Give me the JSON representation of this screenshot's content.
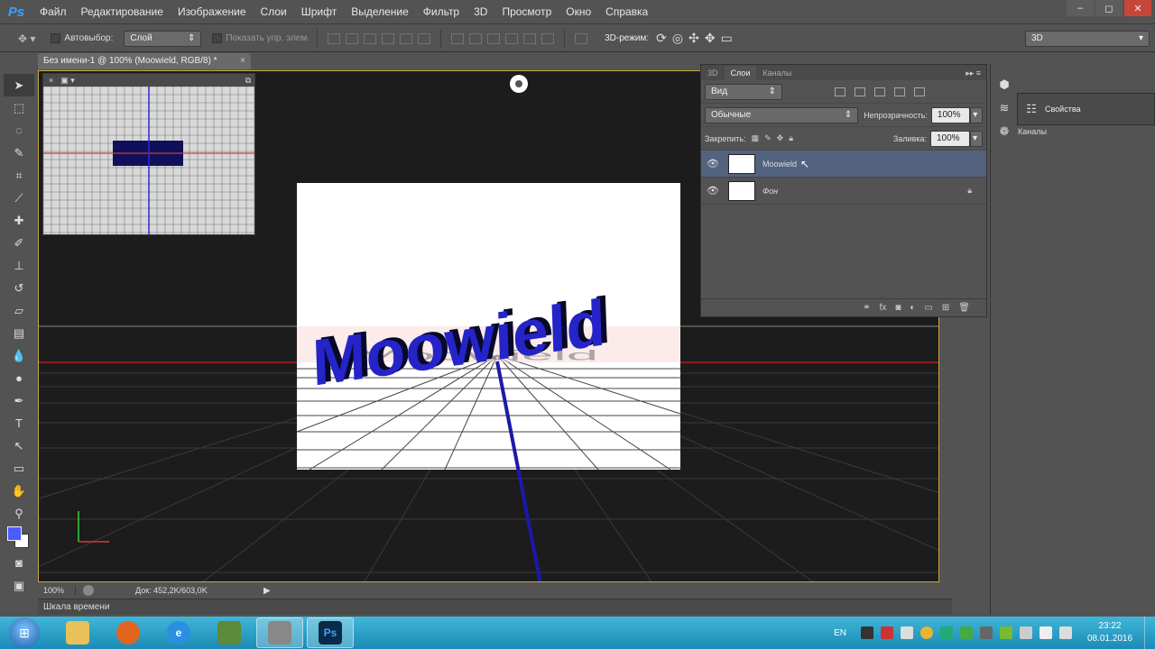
{
  "app": {
    "logo": "Ps",
    "menu": [
      "Файл",
      "Редактирование",
      "Изображение",
      "Слои",
      "Шрифт",
      "Выделение",
      "Фильтр",
      "3D",
      "Просмотр",
      "Окно",
      "Справка"
    ],
    "window_controls": [
      "–",
      "◻",
      "✕"
    ]
  },
  "options_bar": {
    "autoselect_label": "Автовыбор:",
    "autoselect_value": "Слой",
    "show_controls_label": "Показать упр. элем.",
    "mode3d_label": "3D-режим:",
    "workspace_value": "3D"
  },
  "document": {
    "tab_title": "Без имени-1 @ 100% (Moowield, RGB/8) *",
    "text": "Moowield",
    "text_color": "#2424c8"
  },
  "status": {
    "zoom": "100%",
    "doc_info": "Док: 452,2K/603,0K"
  },
  "timeline": {
    "label": "Шкала времени"
  },
  "layers_panel": {
    "tabs": [
      "3D",
      "Слои",
      "Каналы"
    ],
    "active_tab": "Слои",
    "filter_label": "Вид",
    "blend_mode": "Обычные",
    "opacity_label": "Непрозрачность:",
    "opacity_value": "100%",
    "lock_label": "Закрепить:",
    "fill_label": "Заливка:",
    "fill_value": "100%",
    "layers": [
      {
        "name": "Moowield",
        "selected": true,
        "visible": true,
        "locked": false
      },
      {
        "name": "Фон",
        "selected": false,
        "visible": true,
        "locked": true
      }
    ]
  },
  "right_dock": {
    "properties": "Свойства",
    "channels": "Каналы"
  },
  "taskbar": {
    "lang": "EN",
    "time": "23:22",
    "date": "08.01.2016",
    "photoshop_label": "Ps"
  }
}
